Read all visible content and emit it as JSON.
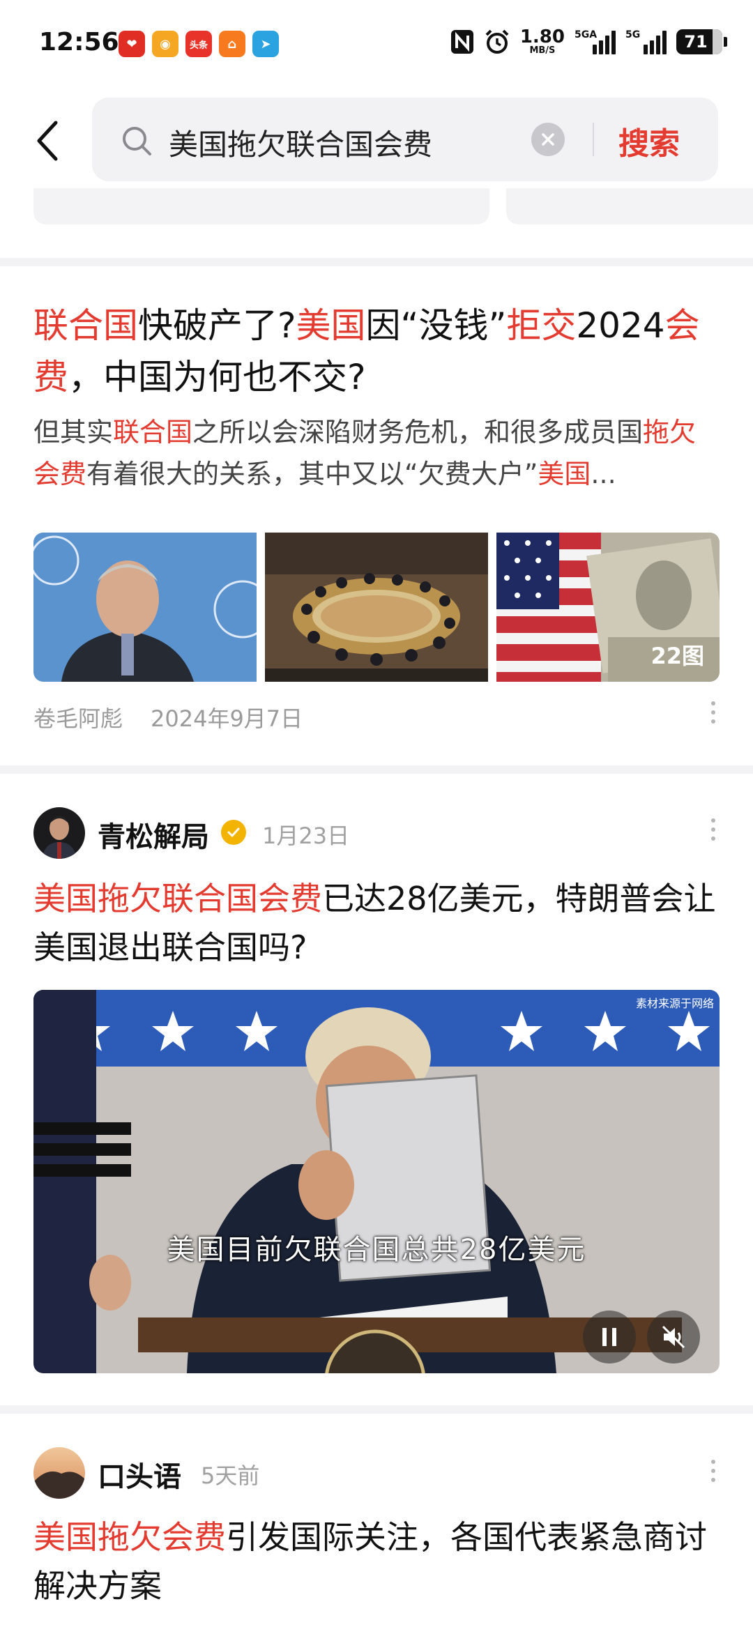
{
  "status_bar": {
    "time": "12:56",
    "net_speed_value": "1.80",
    "net_speed_unit": "MB/S",
    "signal1_label": "5GA",
    "signal2_label": "5G",
    "battery": "71",
    "app_icons": [
      {
        "name": "pinduoduo-icon",
        "color": "#e02e24",
        "glyph": "❤"
      },
      {
        "name": "weibo-icon",
        "color": "#f5a623",
        "glyph": "◉"
      },
      {
        "name": "toutiao-icon",
        "color": "#e8332a",
        "glyph": "头条"
      },
      {
        "name": "orange-app-icon",
        "color": "#f77b1e",
        "glyph": "⌂"
      },
      {
        "name": "telegram-icon",
        "color": "#2aa3e0",
        "glyph": "➤"
      }
    ]
  },
  "search": {
    "query": "美国拖欠联合国会费",
    "button_label": "搜索"
  },
  "article1": {
    "title_parts": [
      {
        "t": "联合国",
        "hl": true
      },
      {
        "t": "快破产了?",
        "hl": false
      },
      {
        "t": "美国",
        "hl": true
      },
      {
        "t": "因“没钱”",
        "hl": false
      },
      {
        "t": "拒交",
        "hl": true
      },
      {
        "t": "2024",
        "hl": false
      },
      {
        "t": "会费",
        "hl": true
      },
      {
        "t": "，中国为何也不交?",
        "hl": false
      }
    ],
    "snippet_parts": [
      {
        "t": "但其实",
        "hl": false
      },
      {
        "t": "联合国",
        "hl": true
      },
      {
        "t": "之所以会深陷财务危机，和很多成员国",
        "hl": false
      },
      {
        "t": "拖欠会费",
        "hl": true
      },
      {
        "t": "有着很大的关系，其中又以“欠费大户”",
        "hl": false
      },
      {
        "t": "美国",
        "hl": true
      },
      {
        "t": "...",
        "hl": false
      }
    ],
    "image_count": "22图",
    "author": "卷毛阿彪",
    "date": "2024年9月7日"
  },
  "post2": {
    "author": "青松解局",
    "date": "1月23日",
    "title_parts": [
      {
        "t": "美国拖欠联合国会费",
        "hl": true
      },
      {
        "t": "已达28亿美元，特朗普会让美国退出联合国吗?",
        "hl": false
      }
    ],
    "video_source": "素材来源于网络",
    "video_caption": "美国目前欠联合国总共28亿美元"
  },
  "post3": {
    "author": "口头语",
    "date": "5天前",
    "title_parts": [
      {
        "t": "美国拖欠会费",
        "hl": true
      },
      {
        "t": "引发国际关注，各国代表紧急商讨解决方案",
        "hl": false
      }
    ]
  },
  "colors": {
    "accent": "#e33b30",
    "meta": "#9a9a9a",
    "separator": "#f3f3f5"
  }
}
